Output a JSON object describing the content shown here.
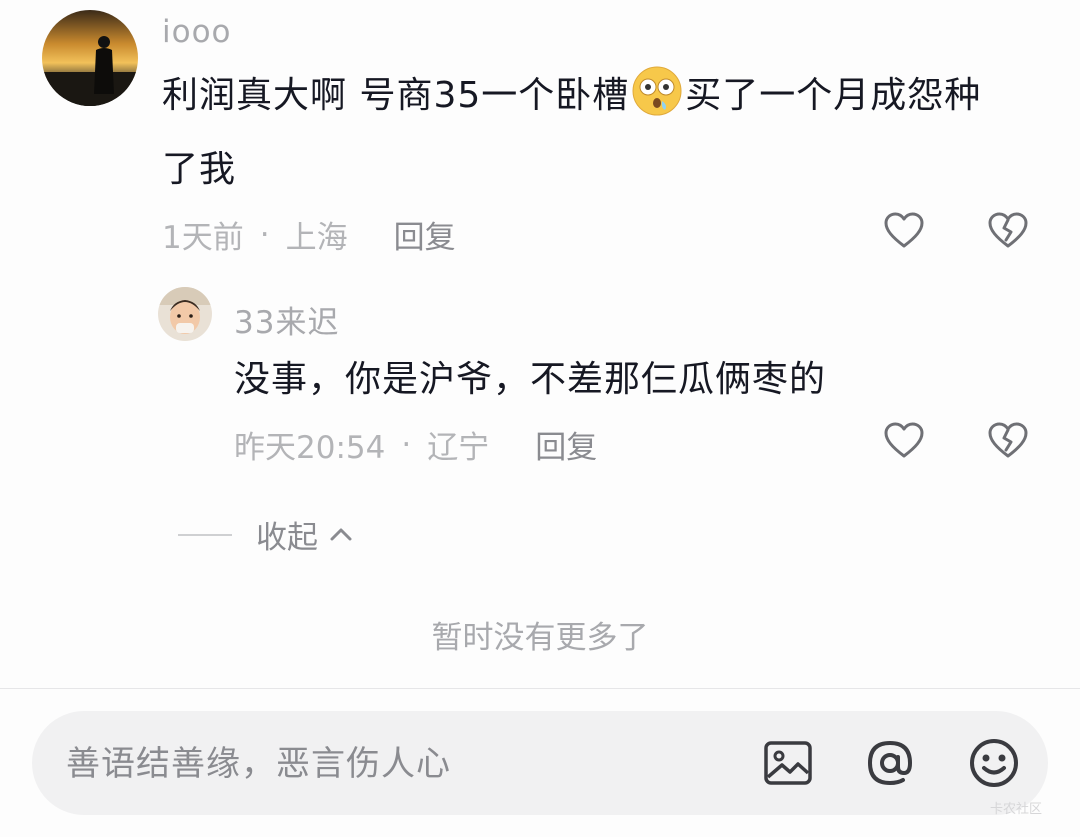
{
  "main_comment": {
    "username": "iooo",
    "text_before_emoji": "利润真大啊 号商35一个卧槽",
    "emoji_icon": "flushed-face-emoji",
    "text_after_emoji": "买了一个月成怨种",
    "text_line2": "了我",
    "time": "1天前",
    "separator": "·",
    "location": "上海",
    "reply_label": "回复"
  },
  "reply_comment": {
    "username": "33来迟",
    "text": "没事，你是沪爷，不差那仨瓜俩枣的",
    "time": "昨天20:54",
    "separator": "·",
    "location": "辽宁",
    "reply_label": "回复"
  },
  "collapse_label": "收起",
  "end_text": "暂时没有更多了",
  "input": {
    "placeholder": "善语结善缘，恶言伤人心"
  },
  "icons": {
    "like": "heart-outline-icon",
    "dislike": "broken-heart-icon",
    "image": "image-icon",
    "mention": "at-icon",
    "emoji": "smiley-icon"
  },
  "colors": {
    "primary_text": "#161823",
    "secondary_text": "#a8a9ad",
    "input_background": "#f1f1f2"
  },
  "watermark": "卡农社区"
}
